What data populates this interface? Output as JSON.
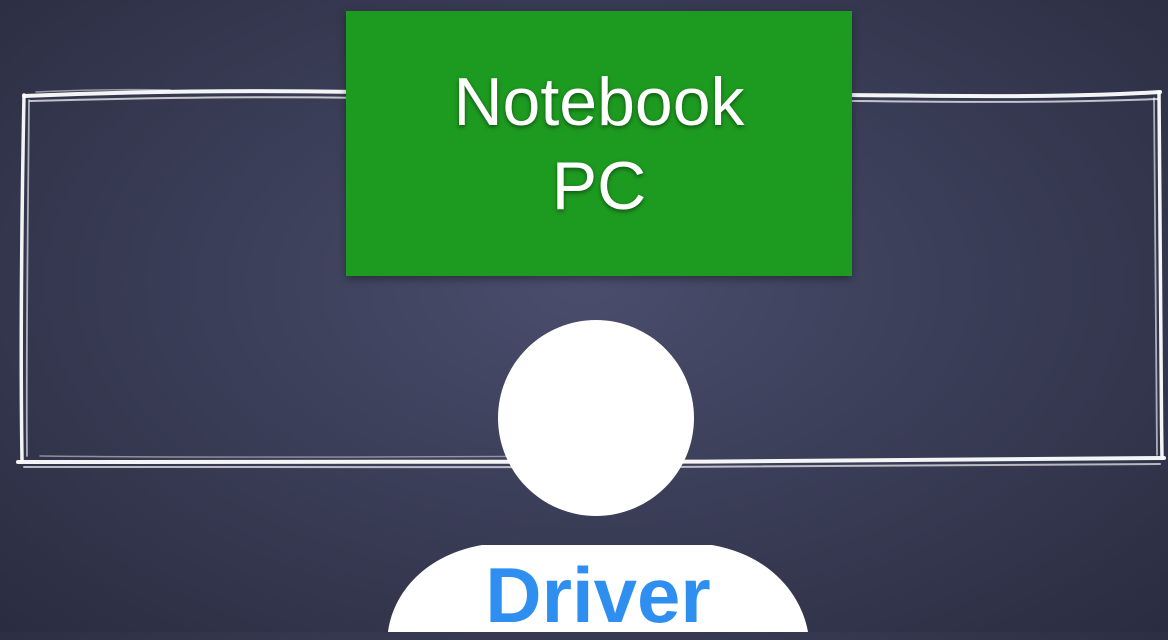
{
  "diagram": {
    "computer_label": "Notebook\nPC",
    "person_label": "Driver"
  },
  "colors": {
    "background": "#3b3e58",
    "computer_box": "#1d9a20",
    "person": "#ffffff",
    "person_label": "#2f8ff0",
    "frame_stroke": "#ffffff"
  },
  "icons": {
    "person": "person-silhouette-icon",
    "frame": "sketch-rectangle"
  }
}
